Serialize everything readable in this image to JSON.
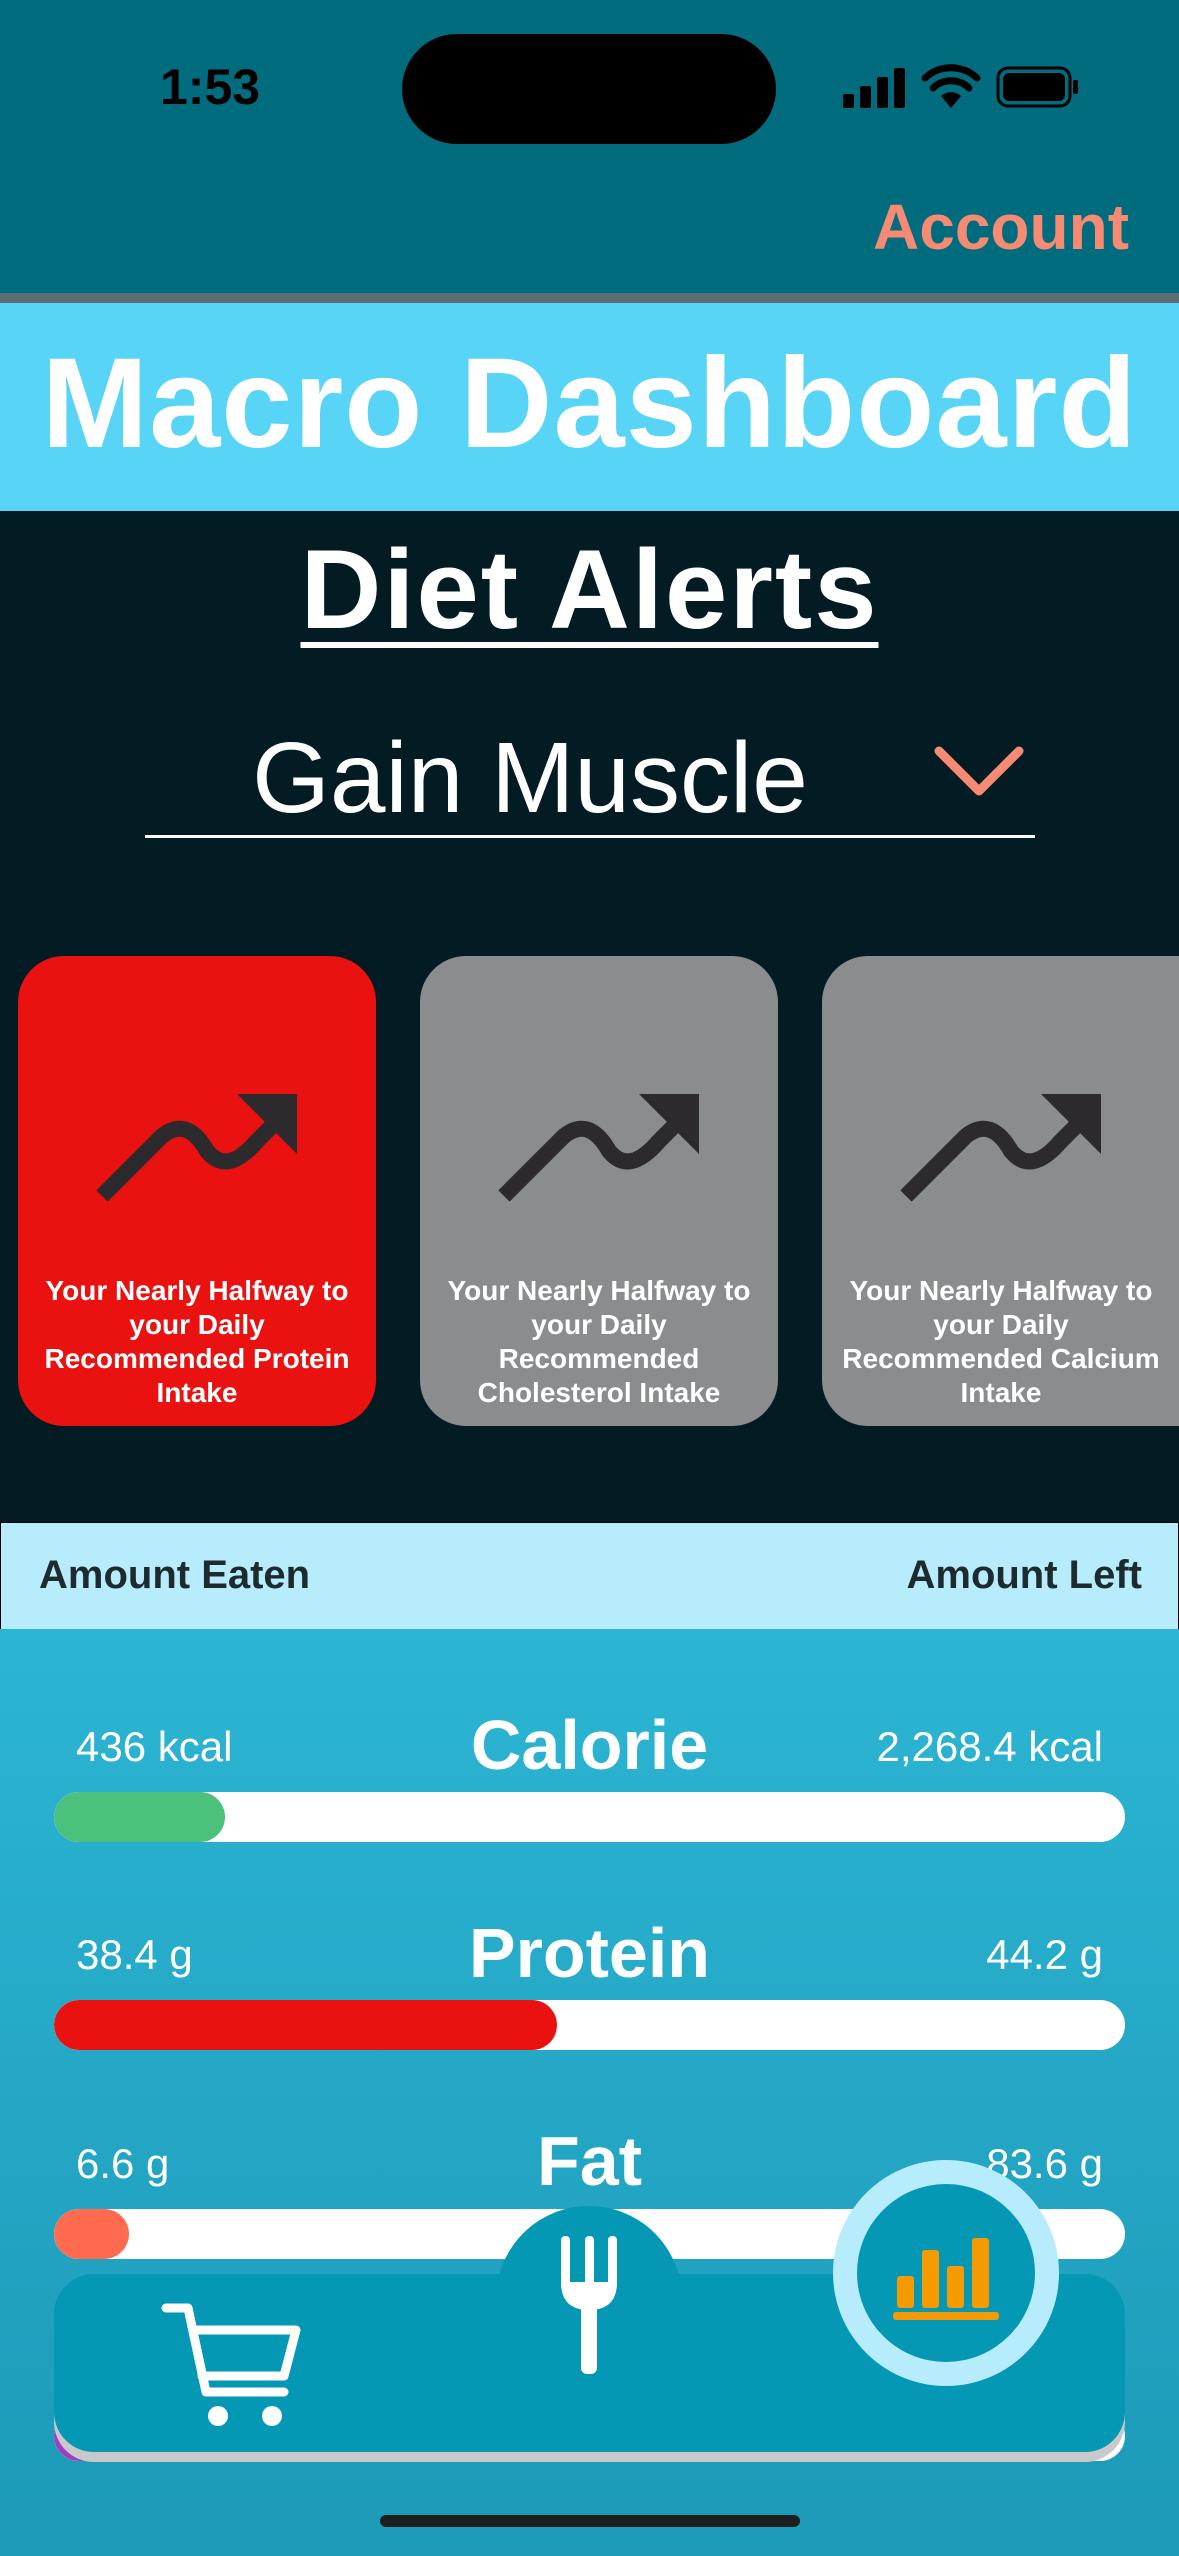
{
  "status_bar": {
    "time": "1:53"
  },
  "header": {
    "account_label": "Account"
  },
  "title": "Macro Dashboard",
  "alerts": {
    "heading": "Diet Alerts",
    "goal": "Gain Muscle",
    "cards": [
      {
        "text": "Your Nearly Halfway to your Daily Recommended Protein Intake",
        "color": "#ea1111",
        "active": true
      },
      {
        "text": "Your Nearly Halfway to your Daily Recommended Cholesterol Intake",
        "color": "#8a8c8e",
        "active": false
      },
      {
        "text": "Your Nearly Halfway to your Daily Recommended Calcium Intake",
        "color": "#8a8c8e",
        "active": false
      }
    ]
  },
  "amounts_header": {
    "eaten": "Amount Eaten",
    "left": "Amount Left"
  },
  "macros": [
    {
      "name": "Calorie",
      "eaten": "436 kcal",
      "left": "2,268.4 kcal",
      "progress": 0.16,
      "color": "#4cc17b"
    },
    {
      "name": "Protein",
      "eaten": "38.4 g",
      "left": "44.2 g",
      "progress": 0.47,
      "color": "#ea1111"
    },
    {
      "name": "Fat",
      "eaten": "6.6 g",
      "left": "83.6 g",
      "progress": 0.07,
      "color": "#ff6b4f"
    },
    {
      "name": "",
      "eaten": "",
      "left": "",
      "progress": 0.14,
      "color": "#a33bc4"
    }
  ],
  "tabs": [
    {
      "icon": "cart-icon",
      "active": false
    },
    {
      "icon": "fork-icon",
      "active": false
    },
    {
      "icon": "bar-chart-icon",
      "active": true
    }
  ],
  "colors": {
    "accent": "#f68a73",
    "active_icon": "#f59a00",
    "title_band": "#57d4f6",
    "top_bar": "#026c7f"
  }
}
